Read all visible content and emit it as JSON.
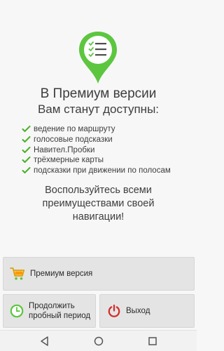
{
  "header": {
    "title_line1": "В Премиум версии",
    "title_line2": "Вам станут доступны:"
  },
  "features": [
    "ведение по маршруту",
    "голосовые подсказки",
    "Навител.Пробки",
    "трёхмерные карты",
    "подсказки при движении по полосам"
  ],
  "cta": {
    "line1": "Воспользуйтесь всеми",
    "line2": "преимуществами своей",
    "line3": "навигации!"
  },
  "buttons": {
    "premium_label": "Премиум версия",
    "trial_label_line1": "Продолжить",
    "trial_label_line2": "пробный период",
    "exit_label": "Выход"
  },
  "icons": {
    "logo": "map-pin-checklist-icon",
    "feature_bullet": "checkmark-icon",
    "premium": "shopping-cart-icon",
    "trial": "clock-icon",
    "exit": "power-icon",
    "nav_back": "back-triangle-icon",
    "nav_home": "home-circle-icon",
    "nav_recent": "recent-square-icon"
  },
  "colors": {
    "brand_green": "#5cc63f",
    "check_green": "#4caf2a",
    "exit_red": "#d32f2f",
    "button_bg": "#e4e4e4",
    "text": "#3d3d3d"
  }
}
